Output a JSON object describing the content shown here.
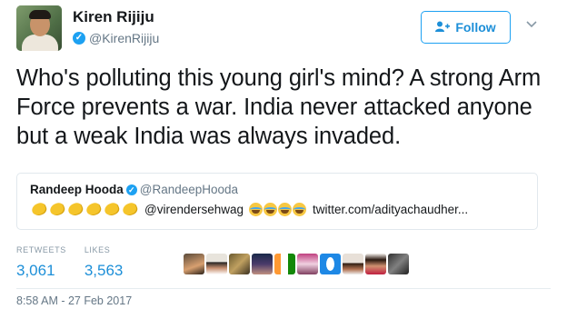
{
  "author": {
    "name": "Kiren Rijiju",
    "handle": "@KirenRijiju",
    "verified_icon": "verified-check-icon"
  },
  "follow_button": {
    "label": "Follow",
    "icon": "add-user-icon"
  },
  "menu_icon": "chevron-down-icon",
  "tweet": {
    "text": "Who's polluting this young girl's mind? A strong Arm Force prevents a war. India never attacked anyone but a weak India was always invaded."
  },
  "quoted_tweet": {
    "name": "Randeep Hooda",
    "handle": "@RandeepHooda",
    "clap_count": 6,
    "mention": "@virendersehwag",
    "joy_count": 4,
    "link": "twitter.com/adityachaudher..."
  },
  "stats": {
    "retweets_label": "RETWEETS",
    "retweets_value": "3,061",
    "likes_label": "LIKES",
    "likes_value": "3,563"
  },
  "likers_count": 10,
  "timestamp": "8:58 AM - 27 Feb 2017",
  "colors": {
    "accent": "#1da1f2",
    "link": "#1d8fd8",
    "secondary_text": "#657786"
  }
}
